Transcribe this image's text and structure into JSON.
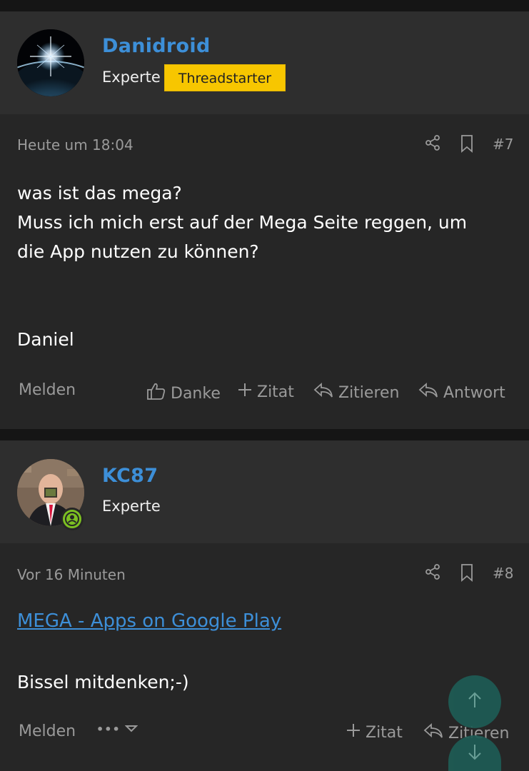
{
  "posts": [
    {
      "username": "Danidroid",
      "role": "Experte",
      "badge": "Threadstarter",
      "timestamp": "Heute um 18:04",
      "post_number": "#7",
      "content_lines": [
        "was ist das mega?",
        "Muss ich mich erst auf der Mega Seite reggen, um",
        "die App nutzen zu können?",
        "",
        "",
        "Daniel"
      ],
      "actions": {
        "report": "Melden",
        "thanks": "Danke",
        "quote_add": "Zitat",
        "quote": "Zitieren",
        "reply": "Antwort"
      }
    },
    {
      "username": "KC87",
      "role": "Experte",
      "timestamp": "Vor 16 Minuten",
      "post_number": "#8",
      "link_text": "MEGA - Apps on Google Play",
      "content_text": "Bissel mitdenken;-)",
      "actions": {
        "report": "Melden",
        "more": "•••",
        "quote_add": "Zitat",
        "quote": "Zitieren"
      }
    }
  ],
  "icons": {
    "share": "share-icon",
    "bookmark": "bookmark-icon",
    "thumb": "thumbs-up-icon",
    "plus": "plus-icon",
    "reply": "reply-icon",
    "scroll_up": "arrow-up-icon",
    "scroll_down": "arrow-down-icon",
    "online": "online-user-icon"
  },
  "colors": {
    "accent": "#3d8fd8",
    "badge": "#f7c600",
    "fab": "#1e5c55",
    "online": "#7cc021"
  }
}
